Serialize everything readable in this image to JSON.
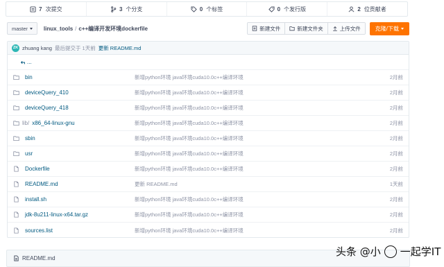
{
  "stats": [
    {
      "count": "7",
      "label": "次提交",
      "icon": "commit-icon"
    },
    {
      "count": "3",
      "label": "个分支",
      "icon": "branch-icon"
    },
    {
      "count": "0",
      "label": "个标签",
      "icon": "tag-icon"
    },
    {
      "count": "0",
      "label": "个发行版",
      "icon": "release-icon"
    },
    {
      "count": "2",
      "label": "位贡献者",
      "icon": "contributors-icon"
    }
  ],
  "toolbar": {
    "branch": "master",
    "repo": "linux_tools",
    "separator": "/",
    "path": "c++编译开发环境dockerfile",
    "new_file": "新建文件",
    "new_folder": "新建文件夹",
    "upload": "上传文件",
    "clone": "克隆/下载"
  },
  "commit": {
    "avatar": "ZK",
    "user": "zhuang kang",
    "meta": "最后提交于 1天前",
    "message": "更新 README.md"
  },
  "back": {
    "label": "..."
  },
  "files": [
    {
      "type": "folder",
      "prefix": "",
      "name": "bin",
      "message": "新增python环境 java环境cuda10.0c++编译环境",
      "age": "2月前"
    },
    {
      "type": "folder",
      "prefix": "",
      "name": "deviceQuery_410",
      "message": "新增python环境 java环境cuda10.0c++编译环境",
      "age": "2月前"
    },
    {
      "type": "folder",
      "prefix": "",
      "name": "deviceQuery_418",
      "message": "新增python环境 java环境cuda10.0c++编译环境",
      "age": "2月前"
    },
    {
      "type": "folder",
      "prefix": "lib/",
      "name": "x86_64-linux-gnu",
      "message": "新增python环境 java环境cuda10.0c++编译环境",
      "age": "2月前"
    },
    {
      "type": "folder",
      "prefix": "",
      "name": "sbin",
      "message": "新增python环境 java环境cuda10.0c++编译环境",
      "age": "2月前"
    },
    {
      "type": "folder",
      "prefix": "",
      "name": "usr",
      "message": "新增python环境 java环境cuda10.0c++编译环境",
      "age": "2月前"
    },
    {
      "type": "file",
      "prefix": "",
      "name": "Dockerfile",
      "message": "新增python环境 java环境cuda10.0c++编译环境",
      "age": "2月前"
    },
    {
      "type": "file",
      "prefix": "",
      "name": "README.md",
      "message": "更新 README.md",
      "age": "1天前"
    },
    {
      "type": "file",
      "prefix": "",
      "name": "install.sh",
      "message": "新增python环境 java环境cuda10.0c++编译环境",
      "age": "2月前"
    },
    {
      "type": "file",
      "prefix": "",
      "name": "jdk-8u211-linux-x64.tar.gz",
      "message": "新增python环境 java环境cuda10.0c++编译环境",
      "age": "2月前"
    },
    {
      "type": "file",
      "prefix": "",
      "name": "sources.list",
      "message": "新增python环境 java环境cuda10.0c++编译环境",
      "age": "2月前"
    }
  ],
  "readme": {
    "title": "README.md"
  },
  "watermark": {
    "left": "头条 @小",
    "right": "一起学IT"
  },
  "colors": {
    "accent": "#fe7300",
    "link": "#005980",
    "avatar": "#2db7b5"
  }
}
